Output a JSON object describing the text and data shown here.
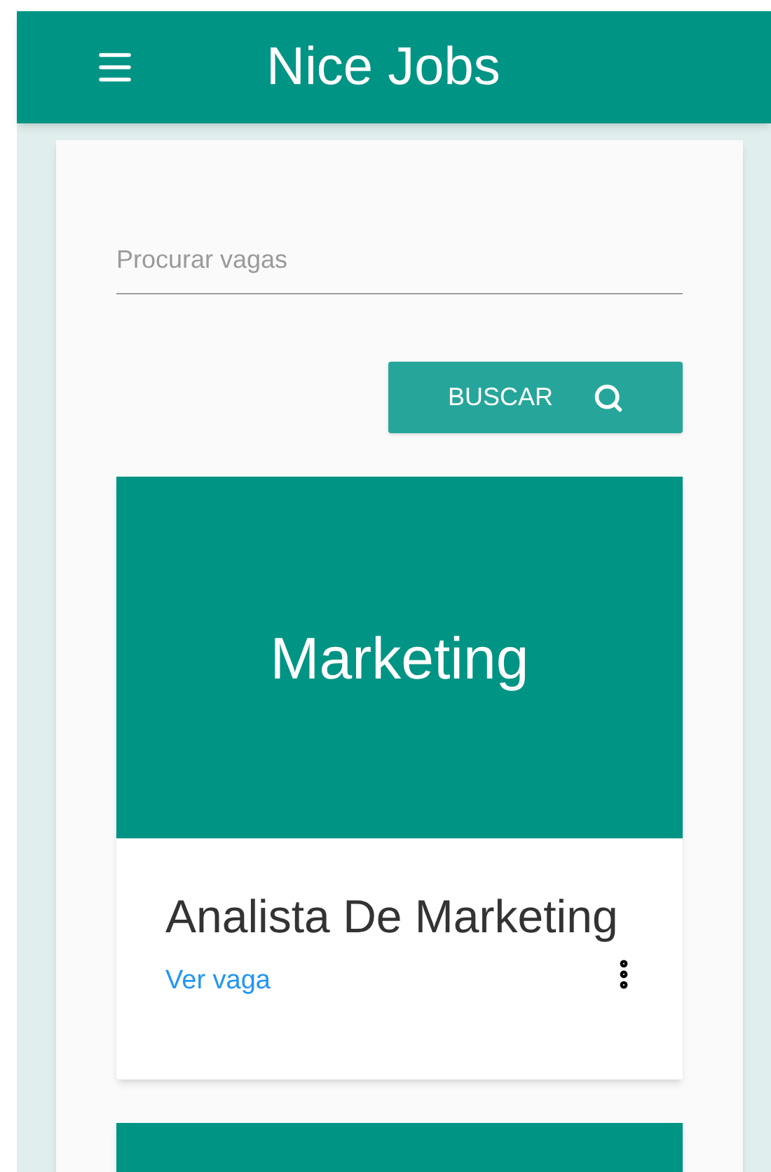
{
  "app_bar": {
    "title": "Nice Jobs"
  },
  "search": {
    "placeholder": "Procurar vagas",
    "button": "BUSCAR"
  },
  "jobs": [
    {
      "category": "Marketing",
      "title": "Analista De Marketing",
      "link": "Ver vaga"
    }
  ]
}
